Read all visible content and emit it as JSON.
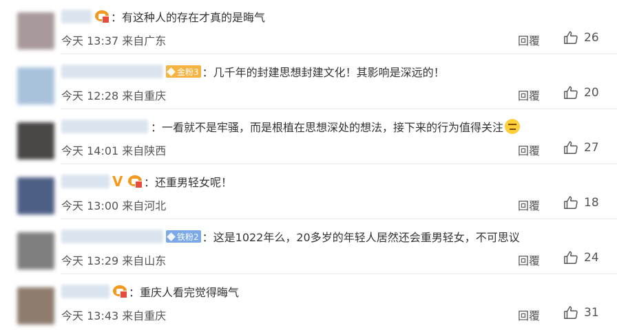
{
  "colors": {
    "text": "#333333",
    "meta": "#555555",
    "gold_badge": "#f5b342",
    "iron_badge": "#7aa8e8",
    "crown": "#f39a1e"
  },
  "comments": [
    {
      "text": "：有这种人的存在才真的是晦气",
      "time": "今天 13:37",
      "location": "来自广东",
      "reply_label": "回覆",
      "likes": "26",
      "avatar_color": "#a8999a",
      "icons": [
        "crown-icon"
      ]
    },
    {
      "text": "：几千年的封建思想封建文化！其影响是深远的！",
      "time": "今天 12:28",
      "location": "来自重庆",
      "reply_label": "回覆",
      "likes": "20",
      "avatar_color": "#a9c2dc",
      "badge": {
        "label": "金粉3",
        "kind": "gold"
      }
    },
    {
      "text": "：一看就不是牢骚，而是根植在思想深处的想法，接下来的行为值得关注",
      "time": "今天 14:01",
      "location": "来自陕西",
      "reply_label": "回覆",
      "likes": "27",
      "avatar_color": "#4a4646",
      "trailing_icon": "emoji-icon"
    },
    {
      "text": "：还重男轻女呢！",
      "time": "今天 13:00",
      "location": "来自河北",
      "reply_label": "回覆",
      "likes": "18",
      "avatar_color": "#4e5f86",
      "icons": [
        "verified-icon",
        "crown-icon"
      ]
    },
    {
      "text": "：这是1022年么，20多岁的年轻人居然还会重男轻女，不可思议",
      "time": "今天 13:29",
      "location": "来自山东",
      "reply_label": "回覆",
      "likes": "24",
      "avatar_color": "#7f7f7f",
      "badge": {
        "label": "铁粉2",
        "kind": "iron"
      }
    },
    {
      "text": "：重庆人看完觉得晦气",
      "time": "今天 13:43",
      "location": "来自重庆",
      "reply_label": "回覆",
      "likes": "31",
      "avatar_color": "#8e7c6e",
      "icons": [
        "crown-icon"
      ]
    }
  ]
}
